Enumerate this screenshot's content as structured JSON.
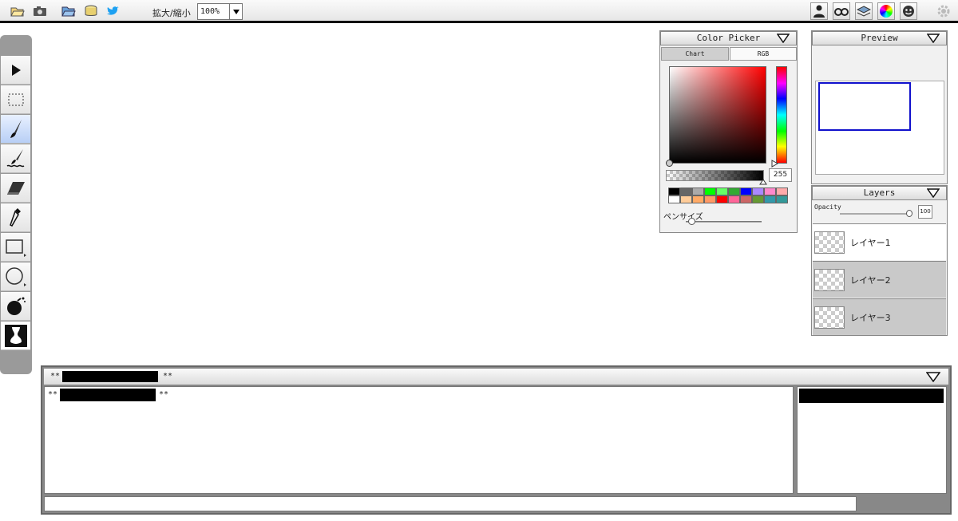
{
  "topbar": {
    "zoom_label": "拡大/縮小",
    "zoom_value": "100%",
    "left_icons": [
      "folder-open-icon",
      "camera-icon",
      "folder-open-icon",
      "database-icon",
      "twitter-icon"
    ],
    "right_icons": [
      "user-icon",
      "glasses-icon",
      "layers-icon",
      "color-wheel-icon",
      "smiley-icon",
      "gear-icon"
    ]
  },
  "tools": [
    "arrow-icon",
    "select-rect-icon",
    "brush-icon",
    "smudge-brush-icon",
    "eraser-icon",
    "dropper-icon",
    "rectangle-icon",
    "circle-icon",
    "bomb-icon",
    "stamp-icon"
  ],
  "color_picker": {
    "title": "Color Picker",
    "tabs": [
      "Chart",
      "RGB"
    ],
    "alpha_value": "255",
    "swatches": [
      "#000000",
      "#666666",
      "#aaaaaa",
      "#00ff00",
      "#66ff66",
      "#33aa33",
      "#0000ff",
      "#aa88ff",
      "#ff88cc",
      "#ffaaaa",
      "#ffffff",
      "#ffcc99",
      "#ffaa66",
      "#ff9966",
      "#ff0000",
      "#ff6699",
      "#cc6666",
      "#669933",
      "#3399aa",
      "#339999"
    ],
    "pen_size_label": "ペンサイズ"
  },
  "preview": {
    "title": "Preview"
  },
  "layers": {
    "title": "Layers",
    "opacity_label": "Opacity",
    "opacity_value": "100",
    "items": [
      {
        "name": "レイヤー1",
        "selected": true
      },
      {
        "name": "レイヤー2",
        "selected": false
      },
      {
        "name": "レイヤー3",
        "selected": false
      }
    ]
  },
  "chat": {
    "header_prefix": "**",
    "header_suffix": "**",
    "log_prefix": "**",
    "log_suffix": "**"
  }
}
